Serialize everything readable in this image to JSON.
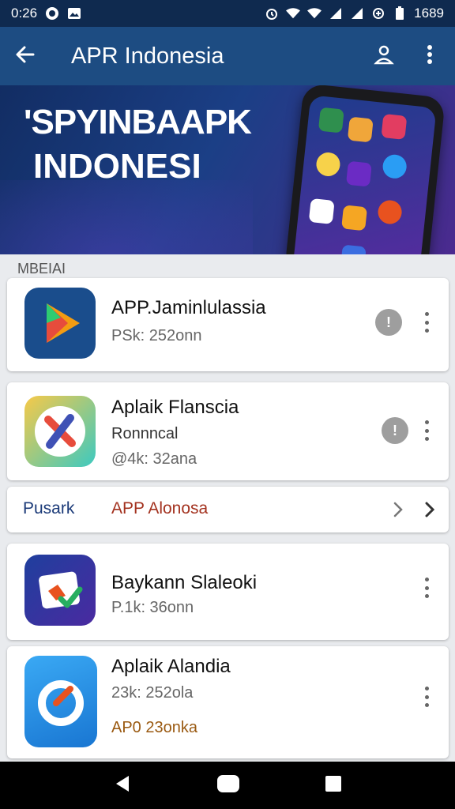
{
  "status_bar": {
    "time": "0:26",
    "battery": "1689"
  },
  "app_bar": {
    "title": "APR Indonesia"
  },
  "banner": {
    "line1": "'SPYINBAAPK",
    "line2": "INDONESI"
  },
  "section": {
    "label": "MBEIAI"
  },
  "apps": [
    {
      "name": "APP.Jaminlulassia",
      "sub": "PSk: 252onn",
      "badge": "!"
    },
    {
      "name": "Aplaik Flanscia",
      "sub": "Ronnncal",
      "sub2": "@4k: 32ana",
      "badge": "!"
    },
    {
      "name": "Baykann Slaleoki",
      "sub": "P.1k: 36onn"
    },
    {
      "name": "Aplaik Alandia",
      "sub": "23k: 252ola",
      "extra": "AP0 23onka"
    }
  ],
  "link_row": {
    "left": "Pusark",
    "middle": "APP Alonosa"
  },
  "colors": {
    "status_bar": "#0f2a4f",
    "app_bar": "#1d4c82",
    "link_left": "#1b3a78",
    "link_middle": "#a3321f"
  },
  "icons": [
    "back-arrow-icon",
    "account-icon",
    "more-vert-icon",
    "play-store-icon",
    "share-icon",
    "edit-icon",
    "chevron-right-icon"
  ]
}
